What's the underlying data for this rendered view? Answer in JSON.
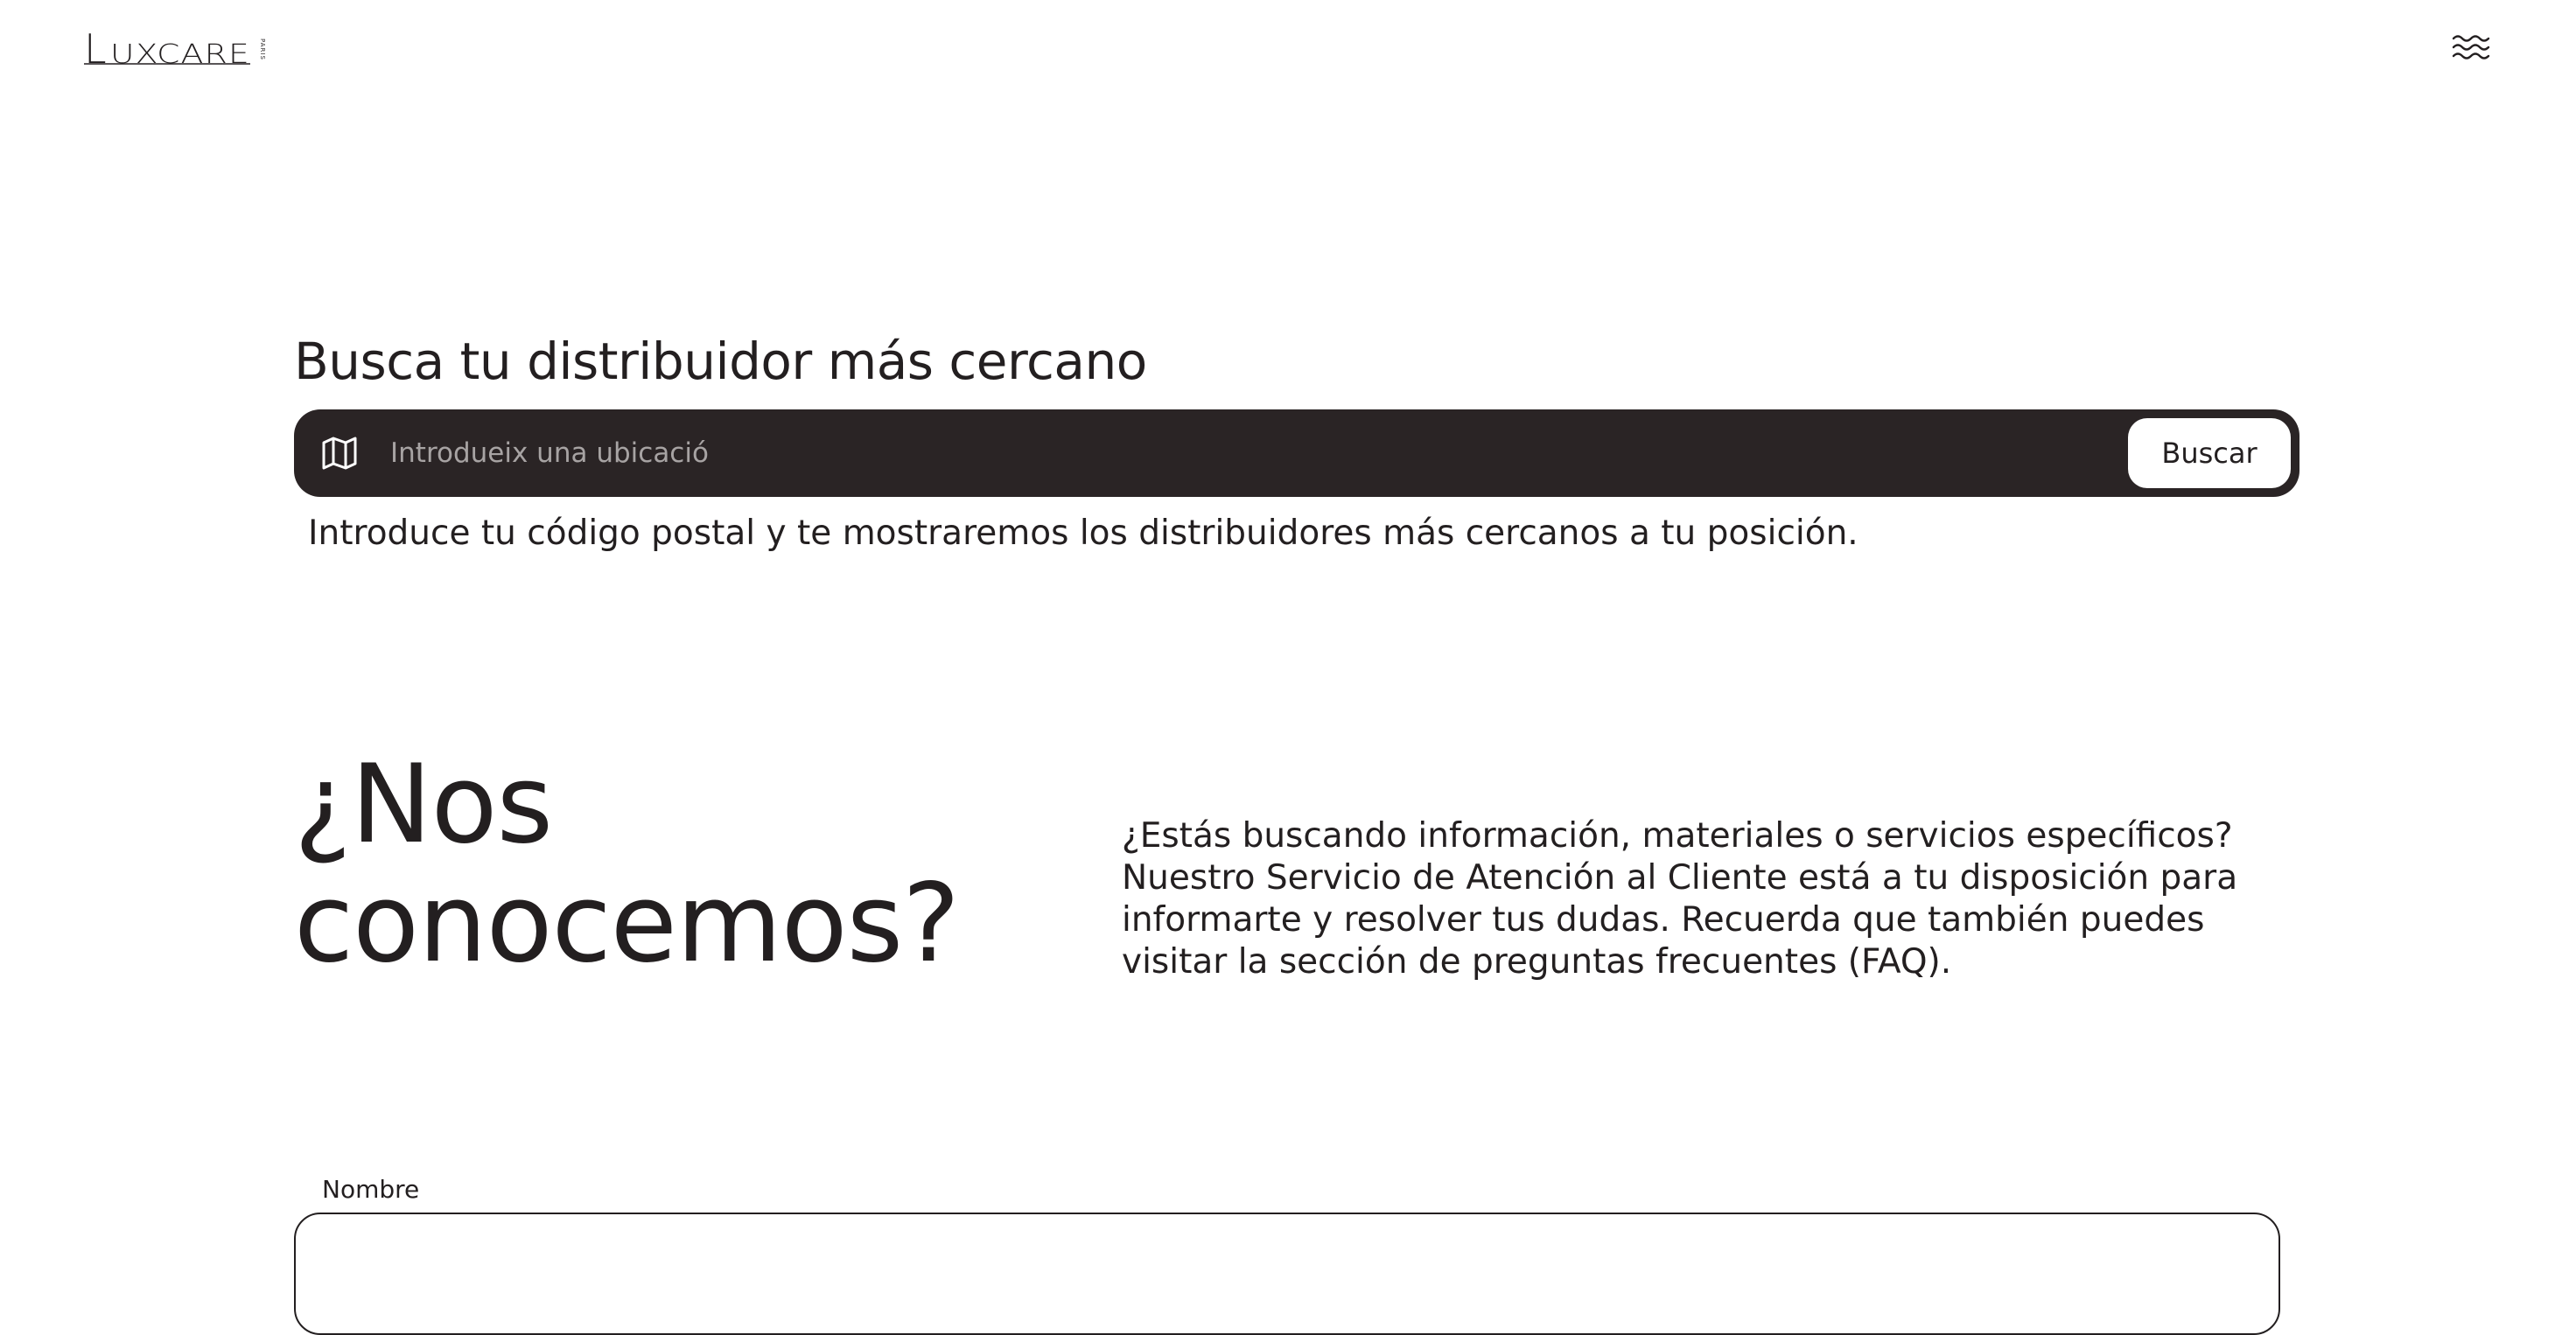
{
  "header": {
    "logo_text": "Luxcare",
    "logo_sub": "PARIS",
    "menu_icon": "waves-menu-icon"
  },
  "locator": {
    "title": "Busca tu distribuidor más cercano",
    "map_icon": "map-icon",
    "search_placeholder": "Introdueix una ubicació",
    "search_value": "",
    "search_button": "Buscar",
    "help_text": "Introduce tu código postal y te mostraremos los distribuidores más cercanos a tu posición."
  },
  "meet": {
    "title_line1": "¿Nos",
    "title_line2": "conocemos?",
    "text": "¿Estás buscando información, materiales o servicios específicos? Nuestro Servicio de Atención al Cliente está a tu disposición para informarte y resolver tus dudas. Recuerda que también puedes visitar la sección de preguntas frecuentes (FAQ)."
  },
  "form": {
    "name_label": "Nombre",
    "name_value": ""
  },
  "colors": {
    "text": "#231f20",
    "search_bar_bg": "#2a2425",
    "placeholder": "#a7a3a3",
    "background": "#ffffff"
  }
}
